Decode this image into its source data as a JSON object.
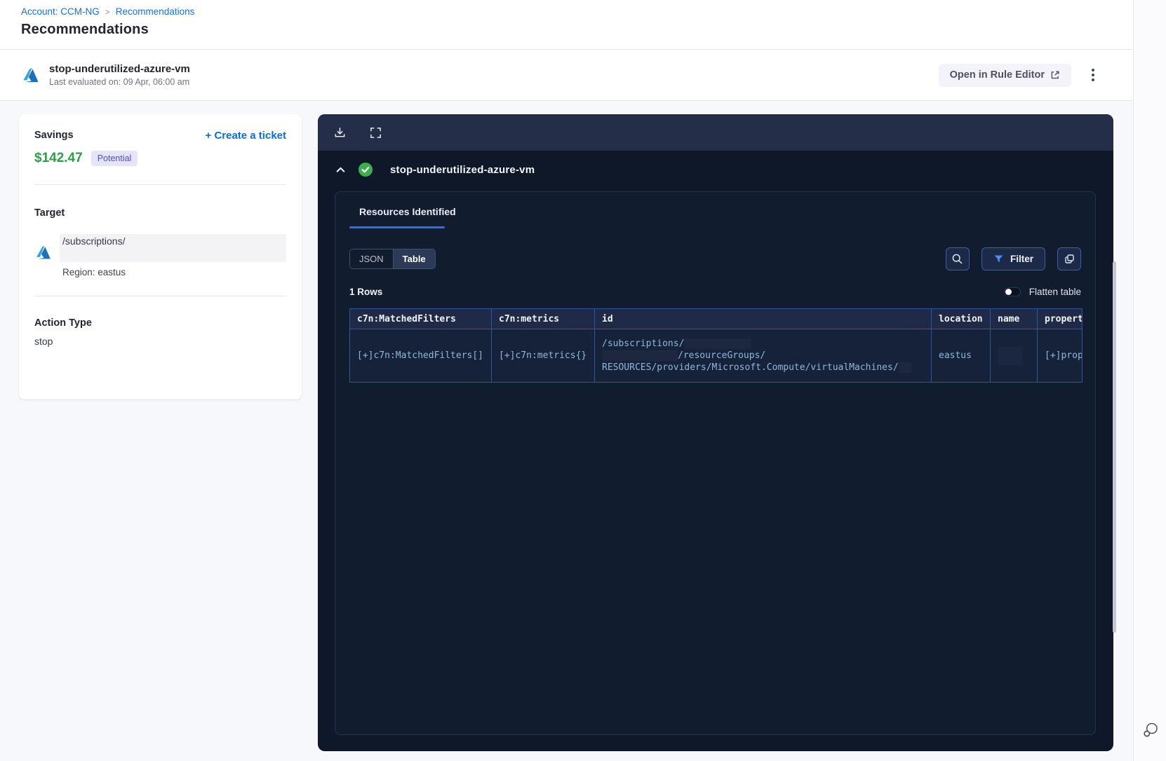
{
  "breadcrumb": {
    "account_link": "Account: CCM-NG",
    "separator": ">",
    "page_link": "Recommendations"
  },
  "page_title": "Recommendations",
  "rule_header": {
    "title": "stop-underutilized-azure-vm",
    "subtitle": "Last evaluated on: 09 Apr, 06:00 am",
    "open_rule_editor_label": "Open in Rule Editor"
  },
  "savings_card": {
    "savings_label": "Savings",
    "amount": "$142.47",
    "badge": "Potential",
    "create_ticket_label": "+ Create a ticket",
    "target_label": "Target",
    "target_path": "/subscriptions/",
    "region": "Region: eastus",
    "action_type_label": "Action Type",
    "action_type_value": "stop"
  },
  "viewer": {
    "rule_title": "stop-underutilized-azure-vm",
    "tab_label": "Resources Identified",
    "view_toggle": {
      "json": "JSON",
      "table": "Table"
    },
    "filter_label": "Filter",
    "rows_label": "1 Rows",
    "flatten_label": "Flatten table",
    "flatten_state": "off",
    "table": {
      "columns": [
        "c7n:MatchedFilters",
        "c7n:metrics",
        "id",
        "location",
        "name",
        "propert"
      ],
      "row": {
        "matched_filters": "[+]c7n:MatchedFilters[]",
        "metrics": "[+]c7n:metrics{}",
        "id_line1": "/subscriptions/",
        "id_line2": "/resourceGroups/",
        "id_line3": "RESOURCES/providers/Microsoft.Compute/virtualMachines/",
        "location": "eastus",
        "name": "",
        "properties": "[+]prop"
      }
    }
  },
  "colors": {
    "link_blue": "#1b6ee3",
    "accent_blue": "#2e6fe8",
    "savings_green": "#2f9e47",
    "badge_bg": "#e5e4fb",
    "badge_text": "#4b50c4",
    "panel_bg": "#0f1828",
    "panel_toolbar_bg": "#242e48",
    "table_border": "#2d5796",
    "table_header_bg": "#1e2a47",
    "cell_value_blue": "#8fb8dc",
    "check_green": "#3daf4e"
  }
}
